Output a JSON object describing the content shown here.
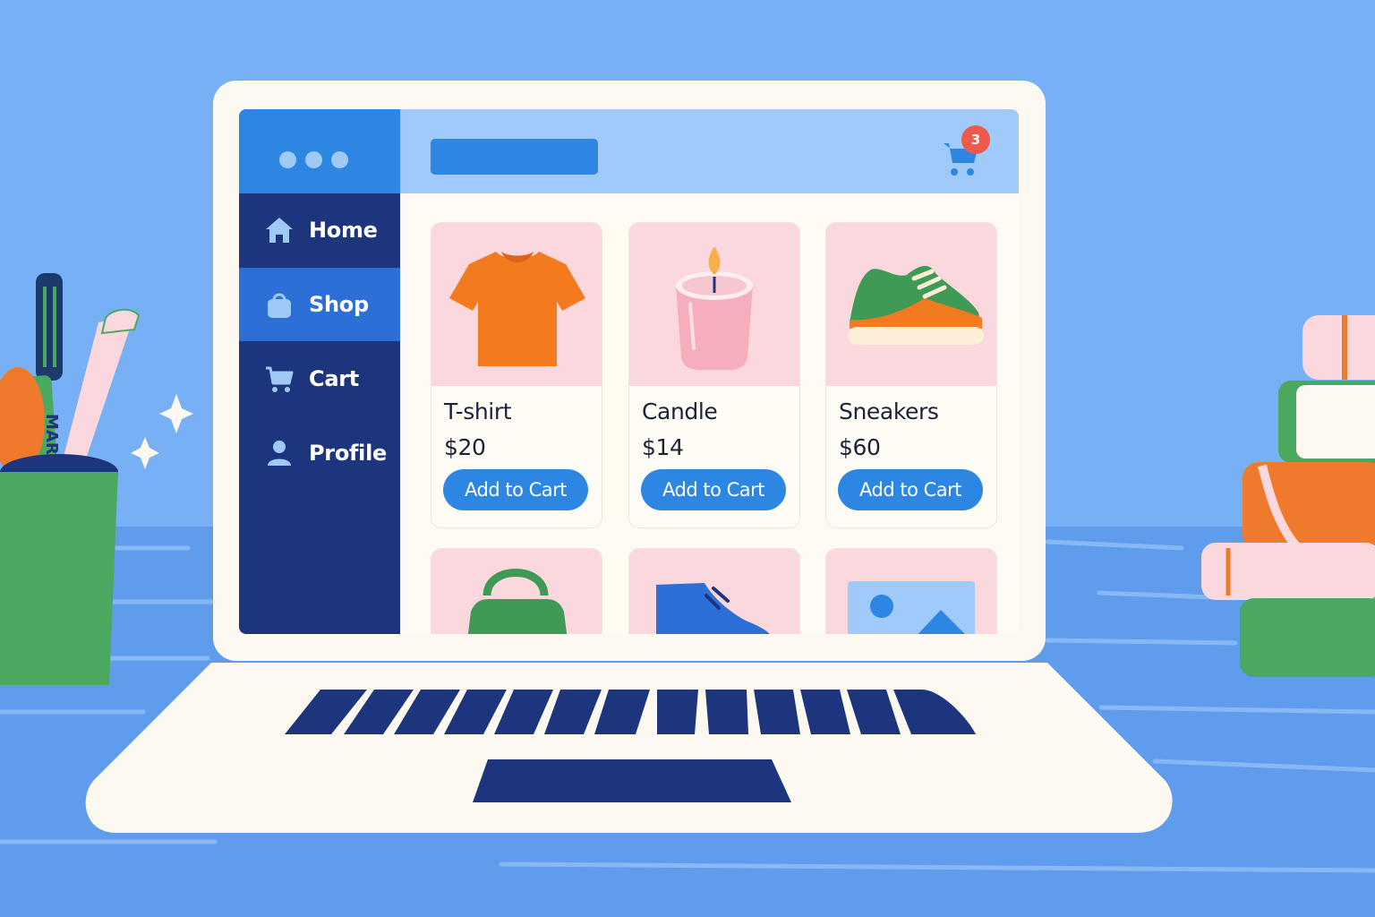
{
  "colors": {
    "background": "#77b0f4",
    "desk": "#5f9cec",
    "sidebar": "#1c357d",
    "sidebar_header": "#2c86e2",
    "sidebar_active": "#2c6fd6",
    "topbar": "#9fcafa",
    "accent": "#2c86e2",
    "badge": "#ef5a4c",
    "card_image_bg": "#fbd7de"
  },
  "window": {
    "controls": [
      "dot-icon",
      "dot-icon",
      "dot-icon"
    ]
  },
  "sidebar": {
    "items": [
      {
        "label": "Home",
        "icon": "home-icon",
        "active": false
      },
      {
        "label": "Shop",
        "icon": "shopping-bag-icon",
        "active": true
      },
      {
        "label": "Cart",
        "icon": "cart-icon",
        "active": false
      },
      {
        "label": "Profile",
        "icon": "user-icon",
        "active": false
      }
    ]
  },
  "topbar": {
    "search_icon": "search-bar",
    "cart_icon": "cart-icon",
    "cart_count": "3"
  },
  "products": [
    {
      "title": "T-shirt",
      "price": "$20",
      "button": "Add to Cart",
      "icon": "tshirt-icon"
    },
    {
      "title": "Candle",
      "price": "$14",
      "button": "Add to Cart",
      "icon": "candle-icon"
    },
    {
      "title": "Sneakers",
      "price": "$60",
      "button": "Add to Cart",
      "icon": "sneaker-icon"
    },
    {
      "icon": "handbag-icon"
    },
    {
      "icon": "boot-icon"
    },
    {
      "icon": "image-placeholder-icon"
    }
  ],
  "decor": {
    "marker_label": "MARK"
  }
}
